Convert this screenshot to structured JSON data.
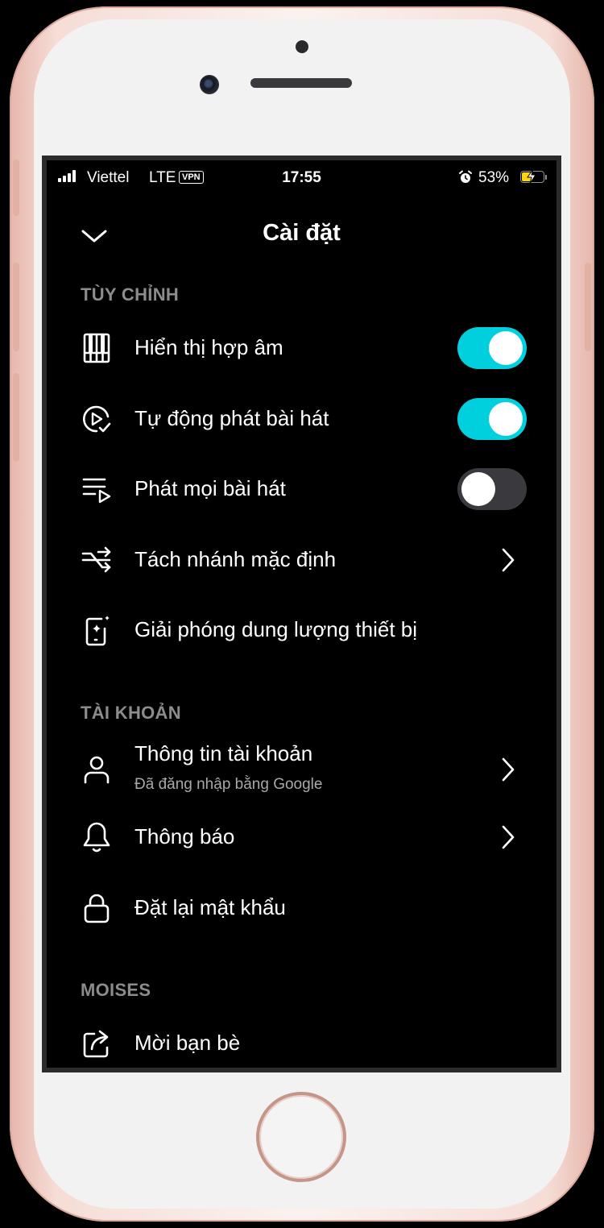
{
  "status_bar": {
    "carrier": "Viettel",
    "network": "LTE",
    "vpn": "VPN",
    "time": "17:55",
    "battery_percent": "53%",
    "battery_level": 0.53,
    "charging": true
  },
  "header": {
    "title": "Cài đặt"
  },
  "sections": {
    "customize": {
      "title": "TÙY CHỈNH",
      "items": [
        {
          "label": "Hiển thị hợp âm",
          "icon": "chord-grid-icon",
          "control": "toggle",
          "on": true
        },
        {
          "label": "Tự động phát bài hát",
          "icon": "autoplay-icon",
          "control": "toggle",
          "on": true
        },
        {
          "label": "Phát mọi bài hát",
          "icon": "playlist-play-icon",
          "control": "toggle",
          "on": false
        },
        {
          "label": "Tách nhánh mặc định",
          "icon": "split-arrows-icon",
          "control": "chevron"
        },
        {
          "label": "Giải phóng dung lượng thiết bị",
          "icon": "phone-sparkle-icon",
          "control": "none"
        }
      ]
    },
    "account": {
      "title": "TÀI KHOẢN",
      "items": [
        {
          "label": "Thông tin tài khoản",
          "sublabel": "Đã đăng nhập bằng Google",
          "icon": "person-icon",
          "control": "chevron"
        },
        {
          "label": "Thông báo",
          "icon": "bell-icon",
          "control": "chevron"
        },
        {
          "label": "Đặt lại mật khẩu",
          "icon": "lock-icon",
          "control": "none"
        }
      ]
    },
    "moises": {
      "title": "MOISES",
      "items": [
        {
          "label": "Mời bạn bè",
          "icon": "share-icon",
          "control": "none"
        }
      ]
    }
  },
  "colors": {
    "accent": "#00d0de",
    "background": "#000000",
    "section_title": "#8c8c8c",
    "toggle_off": "#3a3a3e"
  }
}
